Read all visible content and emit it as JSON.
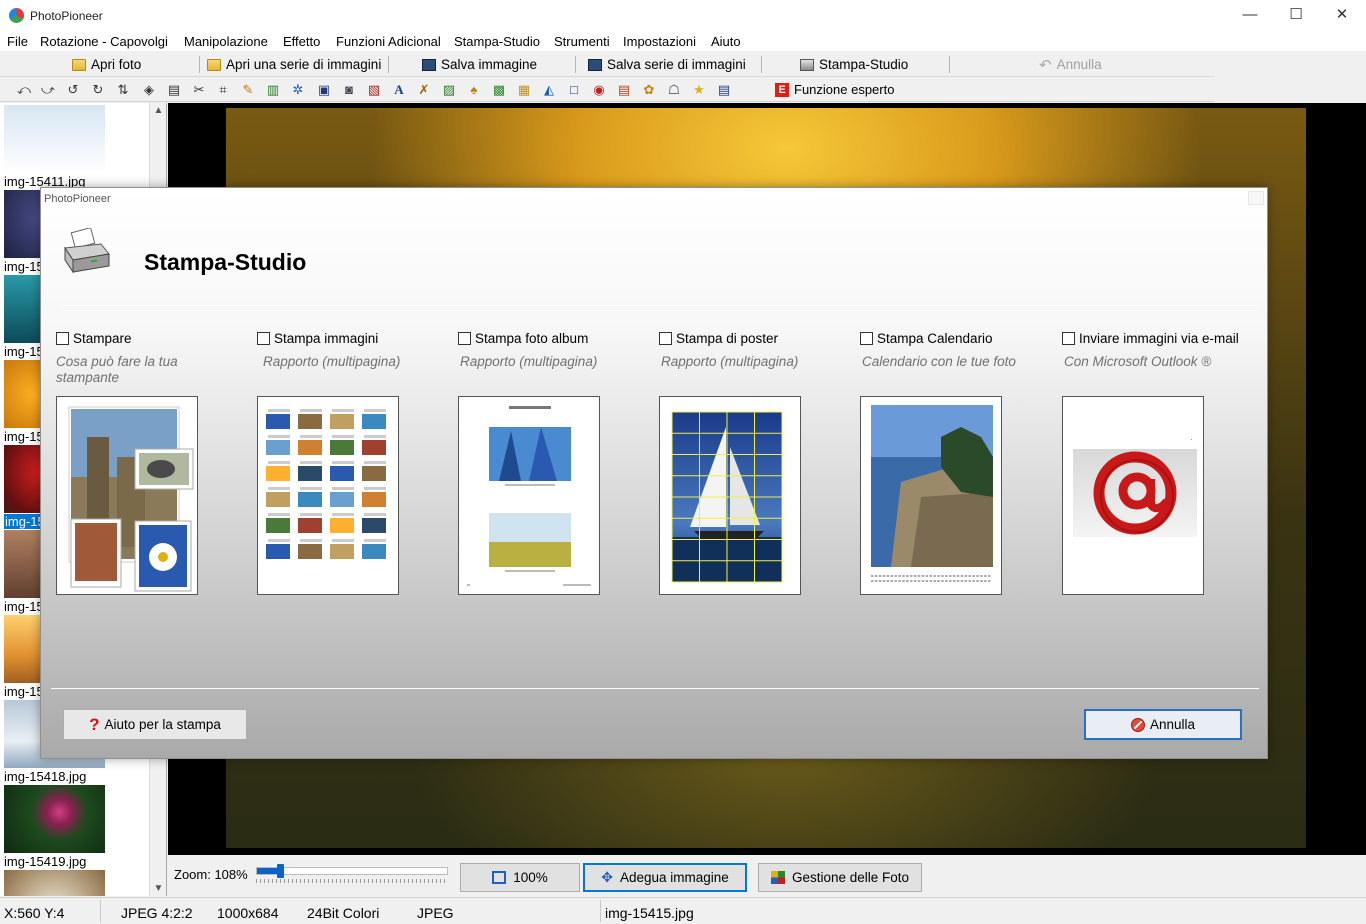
{
  "window": {
    "title": "PhotoPioneer",
    "controls": {
      "minimize": "—",
      "maximize": "☐",
      "close": "✕"
    }
  },
  "menu": [
    "File",
    "Rotazione - Capovolgi",
    "Manipolazione",
    "Effetto",
    "Funzioni Adicional",
    "Stampa-Studio",
    "Strumenti",
    "Impostazioni",
    "Aiuto"
  ],
  "toolbar": {
    "open_photo": "Apri foto",
    "open_series": "Apri una serie di immagini",
    "save_image": "Salva immagine",
    "save_series": "Salva serie di immagini",
    "print_studio": "Stampa-Studio",
    "undo": "Annulla",
    "expert_icon": "E",
    "expert": "Funzione esperto"
  },
  "tool_icons": [
    "rotate-left-icon",
    "rotate-right-icon",
    "rotate-ccw-icon",
    "rotate-cw-icon",
    "flip-icon",
    "perspective-icon",
    "resize-icon",
    "cut-icon",
    "crop-icon",
    "brush-icon",
    "levels-icon",
    "colors-icon",
    "frame-icon",
    "camera-icon",
    "picture-icon",
    "text-icon",
    "tools-icon",
    "landscape-icon",
    "pen-icon",
    "green-photo-icon",
    "photo-icon",
    "adjust-icon",
    "border-icon",
    "red-eye-icon",
    "collage-icon",
    "gift-icon",
    "shape-icon",
    "star-icon",
    "batch-icon"
  ],
  "sidebar": {
    "thumbnails": [
      {
        "label": "img-15411.jpg",
        "selected": false
      },
      {
        "label": "img-15",
        "selected": false
      },
      {
        "label": "img-15",
        "selected": false
      },
      {
        "label": "img-15",
        "selected": false
      },
      {
        "label": "img-15",
        "selected": true
      },
      {
        "label": "img-15",
        "selected": false
      },
      {
        "label": "img-15",
        "selected": false
      },
      {
        "label": "img-15418.jpg",
        "selected": false
      },
      {
        "label": "img-15419.jpg",
        "selected": false
      }
    ]
  },
  "bottombar": {
    "zoom_label": "Zoom: 108%",
    "zoom_fraction": 0.12,
    "btn_100": "100%",
    "btn_fit": "Adegua immagine",
    "btn_manage": "Gestione delle Foto"
  },
  "status": {
    "coords": "X:560 Y:4",
    "format": "JPEG  4:2:2",
    "dims": "1000x684",
    "colors": "24Bit Colori",
    "type": "JPEG",
    "filename": "img-15415.jpg"
  },
  "dialog": {
    "title": "PhotoPioneer",
    "heading": "Stampa-Studio",
    "options": [
      {
        "label": "Stampare",
        "desc": "Cosa può fare la tua stampante"
      },
      {
        "label": "Stampa immagini",
        "desc": "Rapporto (multipagina)"
      },
      {
        "label": "Stampa foto album",
        "desc": "Rapporto (multipagina)"
      },
      {
        "label": "Stampa di poster",
        "desc": "Rapporto (multipagina)"
      },
      {
        "label": "Stampa Calendario",
        "desc": "Calendario con le tue foto"
      },
      {
        "label": "Inviare immagini via e-mail",
        "desc": "Con Microsoft Outlook ®"
      }
    ],
    "help_icon": "?",
    "help_button": "Aiuto per la stampa",
    "cancel_button": "Annulla"
  },
  "colors": {
    "accent": "#0078d7",
    "cancel_icon": "#e24a3c",
    "help_icon": "#d51010",
    "expert_icon": "#e41b13"
  }
}
